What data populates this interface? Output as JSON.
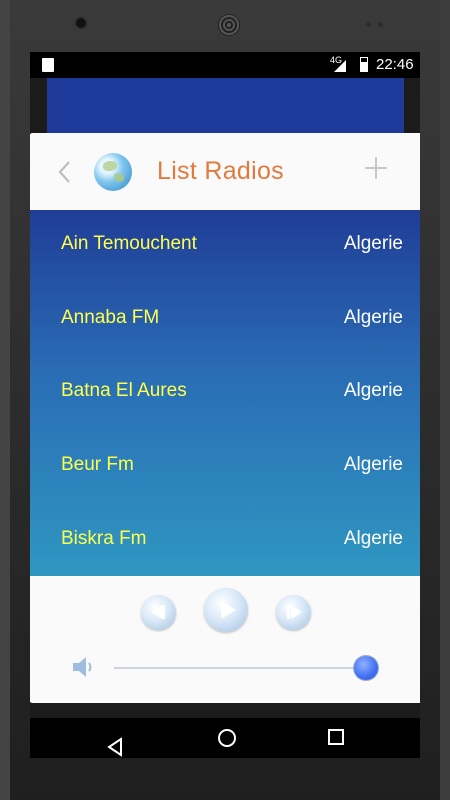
{
  "status_bar": {
    "network": "4G",
    "time": "22:46"
  },
  "header": {
    "title": "List Radios",
    "icons": [
      "back-icon",
      "globe-icon",
      "add-icon"
    ]
  },
  "stations": [
    {
      "name": "Ain Temouchent",
      "country": "Algerie"
    },
    {
      "name": "Annaba FM",
      "country": "Algerie"
    },
    {
      "name": "Batna El Aures",
      "country": "Algerie"
    },
    {
      "name": "Beur Fm",
      "country": "Algerie"
    },
    {
      "name": "Biskra Fm",
      "country": "Algerie"
    }
  ],
  "player": {
    "buttons": [
      "previous-icon",
      "play-icon",
      "next-icon"
    ],
    "volume_level": 1.0
  },
  "colors": {
    "title": "#e07a3d",
    "station_name": "#ffff4d",
    "country": "#ffffff",
    "list_top": "#1f3d97",
    "list_bottom": "#2f97c1",
    "slider_thumb": "#3f6ef1"
  }
}
